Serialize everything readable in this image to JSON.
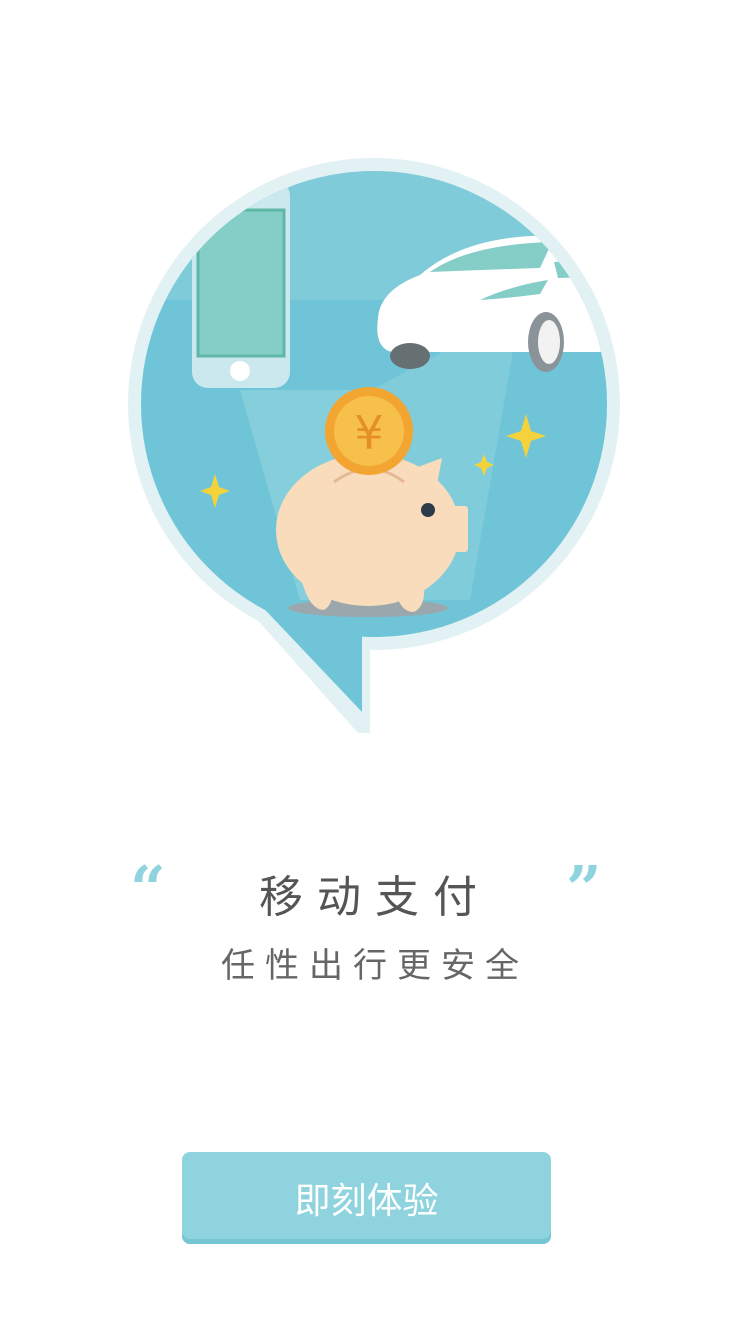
{
  "illustration": {
    "icons": [
      "phone-icon",
      "car-icon",
      "piggy-bank-icon",
      "yuan-coin-icon",
      "sparkle-icon"
    ],
    "coin_symbol": "¥",
    "colors": {
      "bubble": "#6fc5d7",
      "bubble_rim": "#e2f1f3",
      "phone_screen": "#85cdc7",
      "coin": "#f2a531",
      "pig": "#f9dcbc",
      "sparkle": "#f4d23b"
    }
  },
  "quotes": {
    "open": "“",
    "close": "”"
  },
  "message": {
    "headline": "移动支付",
    "subline": "任性出行更安全"
  },
  "cta": {
    "label": "即刻体验",
    "color": "#8ed3de"
  }
}
